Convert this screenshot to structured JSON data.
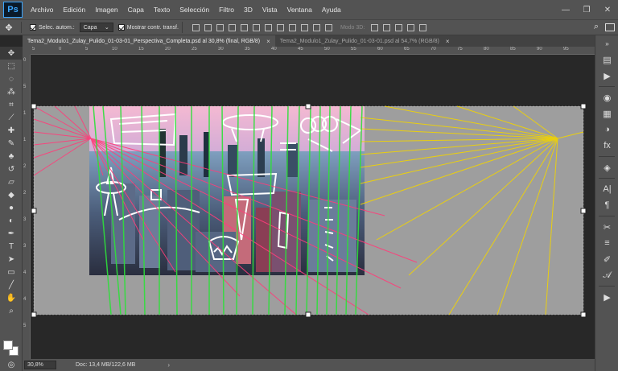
{
  "app": {
    "logo": "Ps"
  },
  "menu": [
    "Archivo",
    "Edición",
    "Imagen",
    "Capa",
    "Texto",
    "Selección",
    "Filtro",
    "3D",
    "Vista",
    "Ventana",
    "Ayuda"
  ],
  "window_controls": {
    "minimize": "—",
    "restore": "❐",
    "close": "✕"
  },
  "options": {
    "auto_select_label": "Selec. autom.:",
    "layer_select_value": "Capa",
    "show_transform_label": "Mostrar contr. transf.",
    "mode_3d_label": "Modo 3D:"
  },
  "tabs": [
    {
      "label": "Tema2_Modulo1_Zulay_Pulido_01-03-01_Perspectiva_Completa.psd al 30,8% (final, RGB/8)",
      "active": true
    },
    {
      "label": "Tema2_Modulo1_Zulay_Pulido_01-03-01.psd al 54,7% (RGB/8)",
      "active": false
    }
  ],
  "tab_close": "×",
  "ruler_h": [
    "5",
    "0",
    "5",
    "10",
    "15",
    "20",
    "25",
    "30",
    "35",
    "40",
    "45",
    "50",
    "55",
    "60",
    "65",
    "70",
    "75",
    "80",
    "85",
    "90",
    "95"
  ],
  "ruler_v": [
    "0",
    "5",
    "1",
    "1",
    "2",
    "2",
    "3",
    "3",
    "4",
    "4",
    "5"
  ],
  "status": {
    "zoom": "30,8%",
    "doc": "Doc: 13,4 MB/122,6 MB",
    "arrow": "›"
  },
  "colors": {
    "chrome": "#535353",
    "workspace": "#282828",
    "canvas_bg": "#9e9e9e",
    "pink_lines": "#ff3d7a",
    "yellow_lines": "#f2d400",
    "green_lines": "#2ee03a"
  }
}
